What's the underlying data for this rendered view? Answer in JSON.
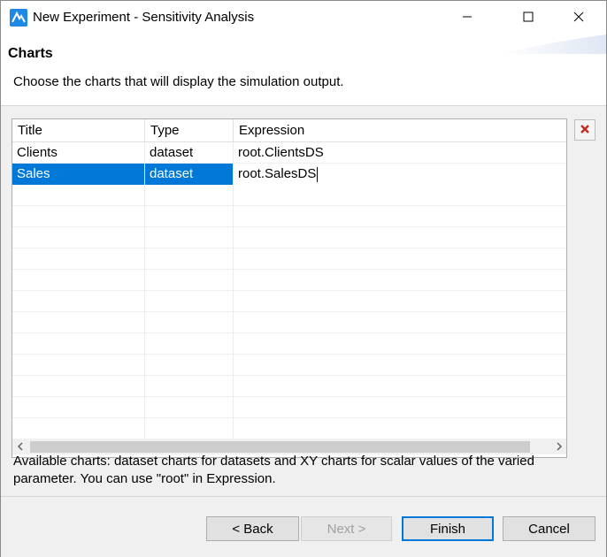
{
  "window": {
    "title": "New Experiment - Sensitivity Analysis"
  },
  "header": {
    "page_title": "Charts",
    "description": "Choose the charts that will display the simulation output."
  },
  "table": {
    "columns": [
      "Title",
      "Type",
      "Expression"
    ],
    "rows": [
      {
        "title": "Clients",
        "type": "dataset",
        "expression": "root.ClientsDS",
        "selected": false
      },
      {
        "title": "Sales",
        "type": "dataset",
        "expression": "root.SalesDS",
        "selected": true
      }
    ]
  },
  "help_text": "Available charts: dataset charts for datasets and XY charts for scalar values of the varied parameter. You can use \"root\" in Expression.",
  "buttons": {
    "back": "< Back",
    "next": "Next >",
    "finish": "Finish",
    "cancel": "Cancel"
  },
  "colors": {
    "selection": "#0078d7",
    "remove_icon": "#c42b1c",
    "app_icon": "#1e88e5"
  },
  "icons": {
    "app": "anylogic-logo-icon",
    "minimize": "minimize-icon",
    "maximize": "maximize-icon",
    "close": "close-icon",
    "remove": "remove-x-icon",
    "scroll_left": "chevron-left-icon",
    "scroll_right": "chevron-right-icon"
  }
}
